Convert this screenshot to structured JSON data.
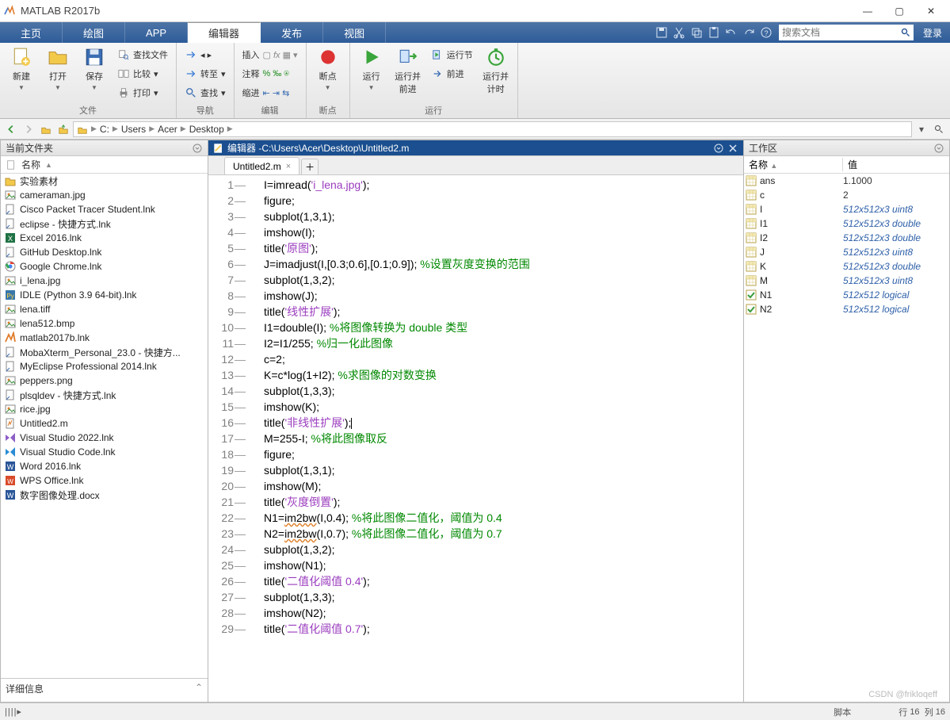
{
  "app": {
    "title": "MATLAB R2017b"
  },
  "win": {
    "min": "—",
    "max": "▢",
    "close": "✕"
  },
  "tabs": {
    "home": "主页",
    "plots": "绘图",
    "apps": "APP",
    "editor": "编辑器",
    "publish": "发布",
    "view": "视图"
  },
  "search": {
    "placeholder": "搜索文档"
  },
  "login": "登录",
  "toolstrip": {
    "file_group": "文件",
    "nav_group": "导航",
    "edit_group": "编辑",
    "bp_group": "断点",
    "run_group": "运行",
    "new": "新建",
    "open": "打开",
    "save": "保存",
    "findfiles": "查找文件",
    "compare": "比较",
    "print": "打印",
    "goto": "转至",
    "find": "查找",
    "insert": "插入",
    "comment": "注释",
    "indent": "缩进",
    "breakpoints": "断点",
    "run": "运行",
    "run_advance": "运行并\n前进",
    "run_section": "运行节",
    "advance": "前进",
    "run_time": "运行并\n计时"
  },
  "path": {
    "segs": [
      "C:",
      "Users",
      "Acer",
      "Desktop"
    ]
  },
  "cf": {
    "title": "当前文件夹",
    "name_col": "名称",
    "details": "详细信息",
    "files": [
      {
        "n": "实验素材",
        "t": "folder"
      },
      {
        "n": "cameraman.jpg",
        "t": "img"
      },
      {
        "n": "Cisco Packet Tracer Student.lnk",
        "t": "lnk"
      },
      {
        "n": "eclipse - 快捷方式.lnk",
        "t": "lnk"
      },
      {
        "n": "Excel 2016.lnk",
        "t": "xls"
      },
      {
        "n": "GitHub Desktop.lnk",
        "t": "lnk"
      },
      {
        "n": "Google Chrome.lnk",
        "t": "chrome"
      },
      {
        "n": "i_lena.jpg",
        "t": "img"
      },
      {
        "n": "IDLE (Python 3.9 64-bit).lnk",
        "t": "py"
      },
      {
        "n": "lena.tiff",
        "t": "img"
      },
      {
        "n": "lena512.bmp",
        "t": "img"
      },
      {
        "n": "matlab2017b.lnk",
        "t": "ml"
      },
      {
        "n": "MobaXterm_Personal_23.0 - 快捷方...",
        "t": "lnk"
      },
      {
        "n": "MyEclipse Professional 2014.lnk",
        "t": "lnk"
      },
      {
        "n": "peppers.png",
        "t": "img"
      },
      {
        "n": "plsqldev - 快捷方式.lnk",
        "t": "lnk"
      },
      {
        "n": "rice.jpg",
        "t": "img"
      },
      {
        "n": "Untitled2.m",
        "t": "m"
      },
      {
        "n": "Visual Studio 2022.lnk",
        "t": "vs"
      },
      {
        "n": "Visual Studio Code.lnk",
        "t": "vsc"
      },
      {
        "n": "Word 2016.lnk",
        "t": "doc"
      },
      {
        "n": "WPS Office.lnk",
        "t": "wps"
      },
      {
        "n": "数字图像处理.docx",
        "t": "doc"
      }
    ]
  },
  "editor": {
    "title_prefix": "编辑器 - ",
    "path": "C:\\Users\\Acer\\Desktop\\Untitled2.m",
    "tab": "Untitled2.m",
    "lines": [
      [
        {
          "t": "I=imread("
        },
        {
          "t": "'i_lena.jpg'",
          "c": "str"
        },
        {
          "t": ");"
        }
      ],
      [
        {
          "t": "figure;"
        }
      ],
      [
        {
          "t": "subplot(1,3,1);"
        }
      ],
      [
        {
          "t": "imshow(I);"
        }
      ],
      [
        {
          "t": "title("
        },
        {
          "t": "'原图'",
          "c": "str"
        },
        {
          "t": ");"
        }
      ],
      [
        {
          "t": "J=imadjust(I,[0.3;0.6],[0.1;0.9]); "
        },
        {
          "t": "%设置灰度变换的范围",
          "c": "cmt"
        }
      ],
      [
        {
          "t": "subplot(1,3,2);"
        }
      ],
      [
        {
          "t": "imshow(J);"
        }
      ],
      [
        {
          "t": "title("
        },
        {
          "t": "'线性扩展'",
          "c": "str"
        },
        {
          "t": ");"
        }
      ],
      [
        {
          "t": "I1=double(I); "
        },
        {
          "t": "%将图像转换为 double 类型",
          "c": "cmt"
        }
      ],
      [
        {
          "t": "I2=I1/255; "
        },
        {
          "t": "%归一化此图像",
          "c": "cmt"
        }
      ],
      [
        {
          "t": "c=2;"
        }
      ],
      [
        {
          "t": "K=c*log(1+I2); "
        },
        {
          "t": "%求图像的对数变换",
          "c": "cmt"
        }
      ],
      [
        {
          "t": "subplot(1,3,3);"
        }
      ],
      [
        {
          "t": "imshow(K);"
        }
      ],
      [
        {
          "t": "title("
        },
        {
          "t": "'非线性扩展'",
          "c": "str"
        },
        {
          "t": ");"
        },
        {
          "t": "|",
          "caret": true
        }
      ],
      [
        {
          "t": "M=255-I; "
        },
        {
          "t": "%将此图像取反",
          "c": "cmt"
        }
      ],
      [
        {
          "t": "figure;"
        }
      ],
      [
        {
          "t": "subplot(1,3,1);"
        }
      ],
      [
        {
          "t": "imshow(M);"
        }
      ],
      [
        {
          "t": "title("
        },
        {
          "t": "'灰度倒置'",
          "c": "str"
        },
        {
          "t": ");"
        }
      ],
      [
        {
          "t": "N1="
        },
        {
          "t": "im2bw",
          "u": true
        },
        {
          "t": "(I,0.4); "
        },
        {
          "t": "%将此图像二值化，阈值为 0.4",
          "c": "cmt"
        }
      ],
      [
        {
          "t": "N2="
        },
        {
          "t": "im2bw",
          "u": true
        },
        {
          "t": "(I,0.7); "
        },
        {
          "t": "%将此图像二值化，阈值为 0.7",
          "c": "cmt"
        }
      ],
      [
        {
          "t": "subplot(1,3,2);"
        }
      ],
      [
        {
          "t": "imshow(N1);"
        }
      ],
      [
        {
          "t": "title("
        },
        {
          "t": "'二值化阈值 0.4'",
          "c": "str"
        },
        {
          "t": ");"
        }
      ],
      [
        {
          "t": "subplot(1,3,3);"
        }
      ],
      [
        {
          "t": "imshow(N2);"
        }
      ],
      [
        {
          "t": "title("
        },
        {
          "t": "'二值化阈值 0.7'",
          "c": "str"
        },
        {
          "t": ");"
        }
      ]
    ]
  },
  "ws": {
    "title": "工作区",
    "name_col": "名称",
    "val_col": "值",
    "vars": [
      {
        "n": "ans",
        "v": "1.1000",
        "it": false,
        "ic": "num"
      },
      {
        "n": "c",
        "v": "2",
        "it": false,
        "ic": "num"
      },
      {
        "n": "I",
        "v": "512x512x3 uint8",
        "it": true,
        "ic": "num"
      },
      {
        "n": "I1",
        "v": "512x512x3 double",
        "it": true,
        "ic": "num"
      },
      {
        "n": "I2",
        "v": "512x512x3 double",
        "it": true,
        "ic": "num"
      },
      {
        "n": "J",
        "v": "512x512x3 uint8",
        "it": true,
        "ic": "num"
      },
      {
        "n": "K",
        "v": "512x512x3 double",
        "it": true,
        "ic": "num"
      },
      {
        "n": "M",
        "v": "512x512x3 uint8",
        "it": true,
        "ic": "num"
      },
      {
        "n": "N1",
        "v": "512x512 logical",
        "it": true,
        "ic": "chk"
      },
      {
        "n": "N2",
        "v": "512x512 logical",
        "it": true,
        "ic": "chk"
      }
    ]
  },
  "status": {
    "script": "脚本",
    "row_lbl": "行",
    "row": "16",
    "col_lbl": "列",
    "col": "16"
  },
  "watermark": "CSDN @frikloqeff"
}
